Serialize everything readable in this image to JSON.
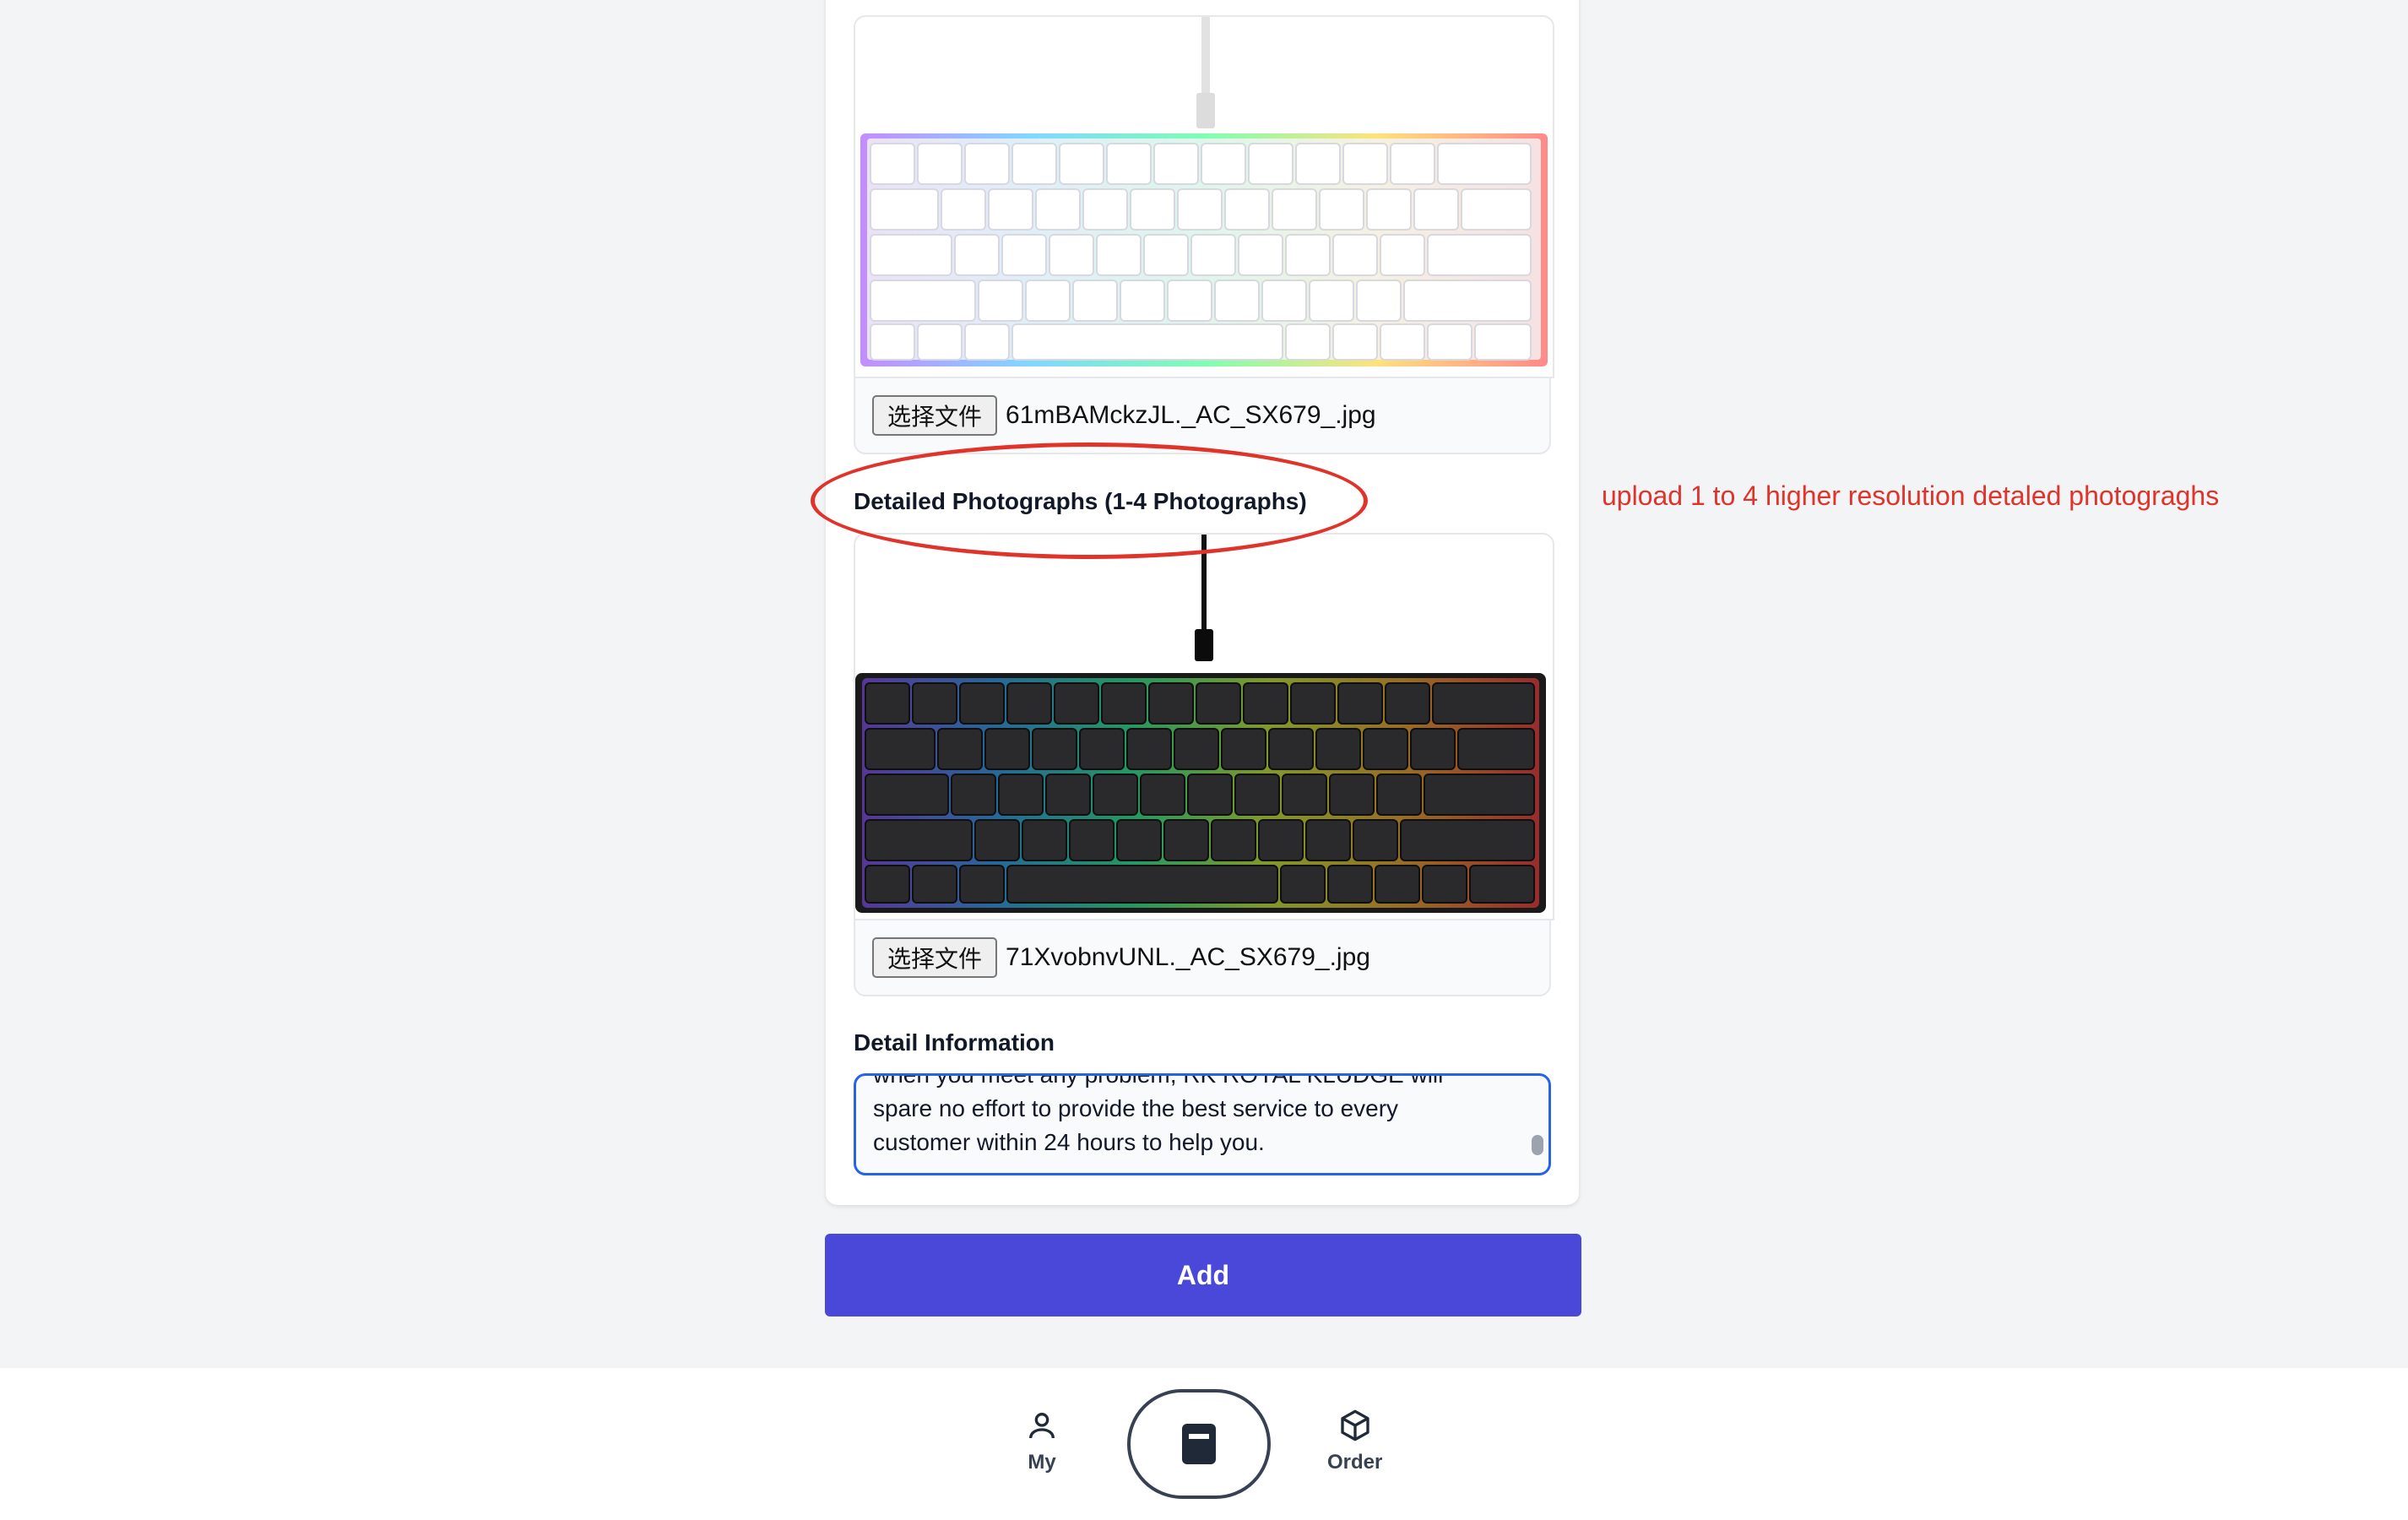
{
  "section_top": {
    "file_button_label": "选择文件",
    "file_name": "61mBAMckzJL._AC_SX679_.jpg"
  },
  "detailed_photos": {
    "label": "Detailed Photographs (1-4 Photographs)",
    "file_button_label": "选择文件",
    "file_name": "71XvobnvUNL._AC_SX679_.jpg"
  },
  "detail_info": {
    "label": "Detail Information",
    "lines": [
      "when you meet any problem, RK ROYAL KLUDGE will",
      "spare no effort to provide the best service to every",
      "customer within 24 hours to help you."
    ]
  },
  "add_button": {
    "label": "Add"
  },
  "annotation": {
    "text": "upload 1 to 4 higher resolution detaled photograghs",
    "color": "#e0332a"
  },
  "nav": {
    "my_label": "My",
    "order_label": "Order",
    "my_icon": "user-icon",
    "center_icon": "product-icon",
    "order_icon": "box-icon"
  },
  "colors": {
    "primary": "#4a48d9",
    "focus_border": "#2563eb",
    "annotation": "#e0332a"
  }
}
